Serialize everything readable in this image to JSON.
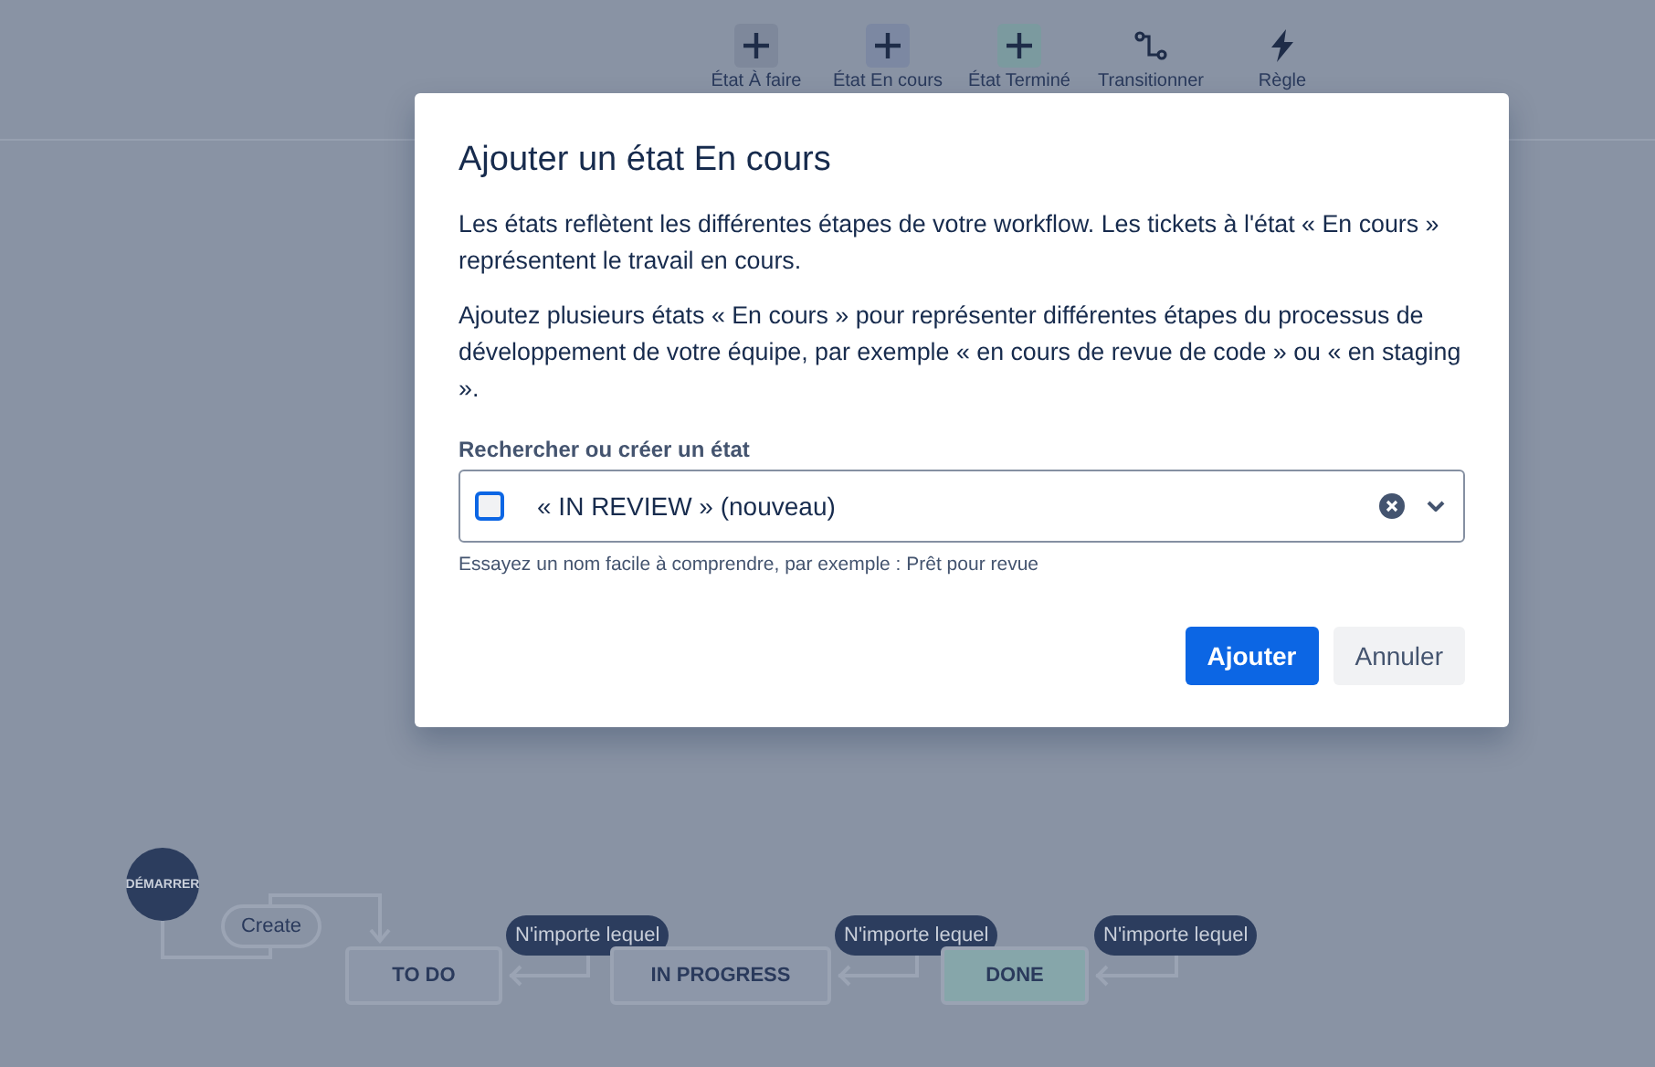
{
  "toolbar": {
    "items": [
      {
        "label": "État À faire",
        "kind": "add",
        "color": "#7e889b"
      },
      {
        "label": "État En cours",
        "kind": "add",
        "color": "#7c88a2"
      },
      {
        "label": "État Terminé",
        "kind": "add",
        "color": "#7b9a9f"
      },
      {
        "label": "Transitionner",
        "kind": "transition"
      },
      {
        "label": "Règle",
        "kind": "rule"
      }
    ]
  },
  "dialog": {
    "title": "Ajouter un état En cours",
    "paragraphs": [
      "Les états reflètent les différentes étapes de votre workflow. Les tickets à l'état « En cours » représentent le travail en cours.",
      "Ajoutez plusieurs états « En cours » pour représenter différentes étapes du processus de développement de votre équipe, par exemple « en cours de revue de code » ou « en staging »."
    ],
    "field": {
      "label": "Rechercher ou créer un état",
      "value": "« IN REVIEW » (nouveau)",
      "checked": false,
      "helper": "Essayez un nom facile à comprendre, par exemple : Prêt pour revue"
    },
    "buttons": [
      {
        "label": "Ajouter",
        "kind": "primary"
      },
      {
        "label": "Annuler",
        "kind": "secondary"
      }
    ]
  },
  "canvas": {
    "start": "DÉMARRER",
    "create_transition": "Create",
    "statuses": [
      {
        "label": "TO DO",
        "color": "#8d97a9",
        "global_transition": "N'importe lequel"
      },
      {
        "label": "IN PROGRESS",
        "color": "#8d97a9",
        "global_transition": "N'importe lequel"
      },
      {
        "label": "DONE",
        "color": "#86a6aa",
        "global_transition": "N'importe lequel"
      }
    ]
  }
}
